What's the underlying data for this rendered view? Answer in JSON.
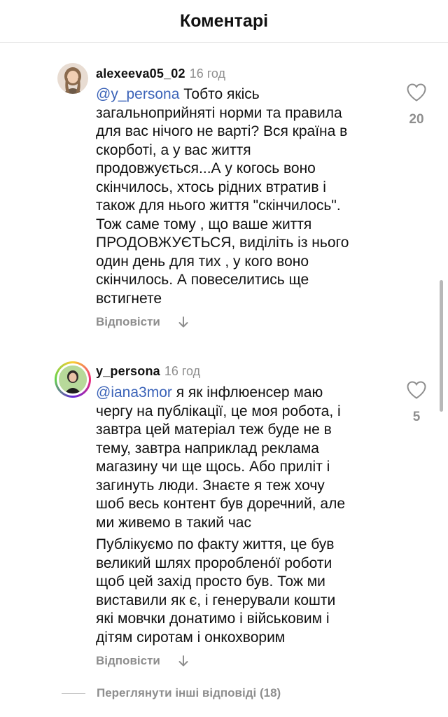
{
  "header": {
    "title": "Коментарі"
  },
  "comments": [
    {
      "username": "alexeeva05_02",
      "time": "16 год",
      "mention": "@y_persona",
      "text": " Тобто якісь\nзагальноприйняті норми та правила\nдля вас нічого не варті? Вся країна в\nскорботі, а у вас життя\nпродовжується...А у когось воно\nскінчилось, хтось рідних втратив і\nтакож для нього життя \"скінчилось\".\nТож саме тому , що ваше життя\nПРОДОВЖУЄТЬСЯ, виділіть із нього\nодин день для тих , у кого воно\nскінчилось. А повеселитись ще\nвстигнете",
      "reply_label": "Відповісти",
      "like_count": "20",
      "icons": {
        "like": "heart-outline-icon",
        "reply": "arrow-down-icon"
      }
    },
    {
      "username": "y_persona",
      "time": "16 год",
      "mention": "@iana3mor",
      "text": " я як інфлюенсер маю\nчергу на публікації, це моя робота, і\nзавтра цей матеріал теж буде не в\nтему, завтра наприклад реклама\nмагазину чи ще щось. Або приліт і\nзагинуть люди. Знаєте я теж хочу\nшоб весь контент був доречний, але\nми живемо в такий час",
      "text2": "Публікуємо по факту життя, це був\nвеликий шлях пророблено́ї роботи\nщоб цей захід просто був. Тож ми\nвиставили як є, і генерували кошти\nякі мовчки донатимо і військовим і\nдітям сиротам і онкохворим",
      "reply_label": "Відповісти",
      "like_count": "5",
      "icons": {
        "like": "heart-outline-icon",
        "reply": "arrow-down-icon"
      }
    }
  ],
  "more_replies": {
    "label": "Переглянути інші відповіді (18)"
  },
  "colors": {
    "mention": "#3b63b8",
    "muted": "#8e8e8e",
    "text": "#111111"
  }
}
